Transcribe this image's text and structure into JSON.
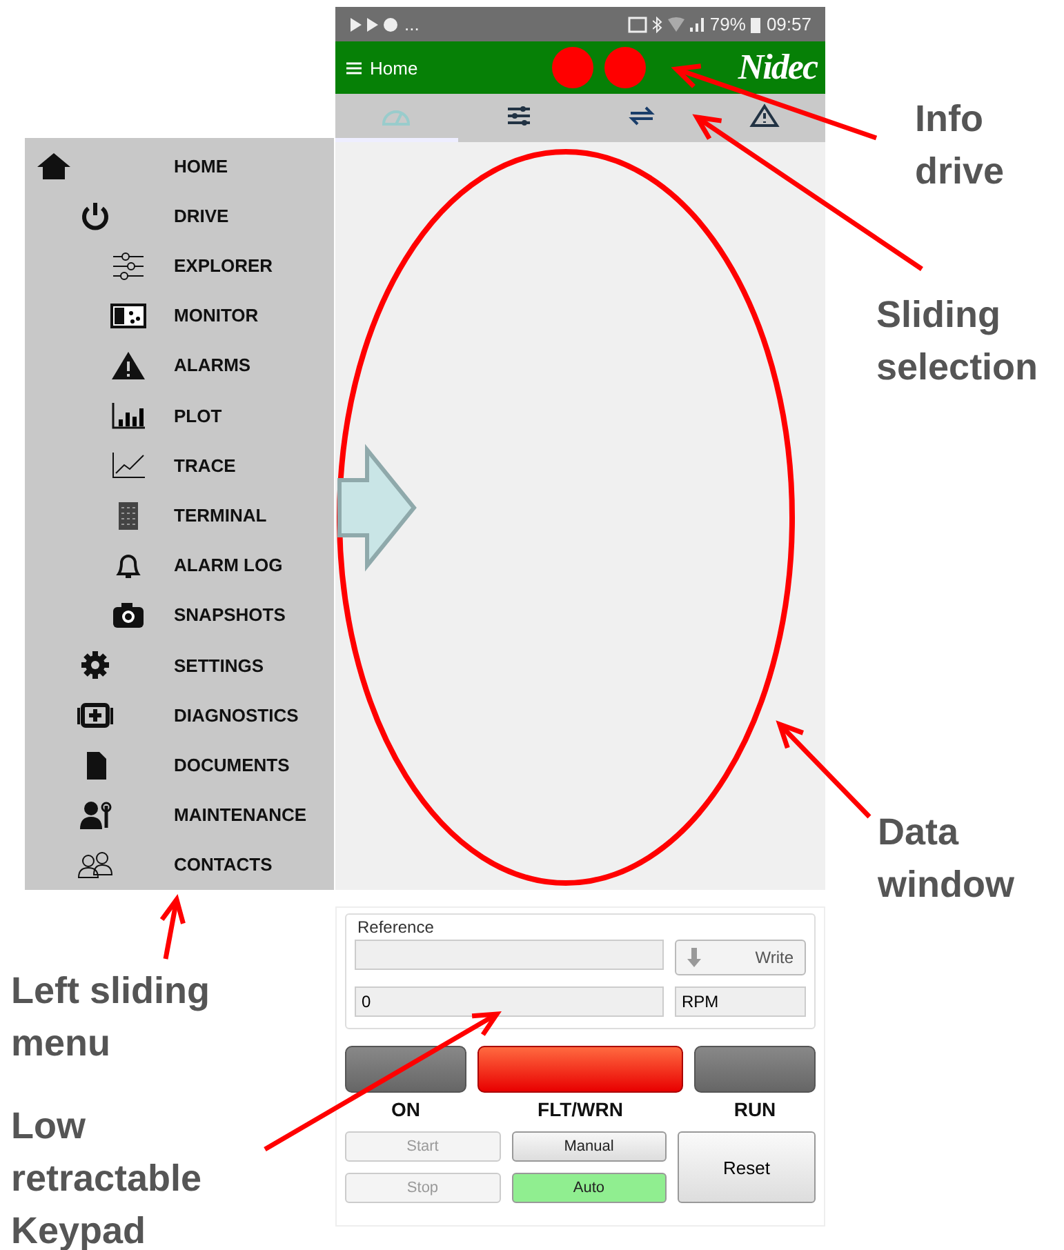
{
  "status_bar": {
    "more": "...",
    "battery": "79%",
    "time": "09:57"
  },
  "header": {
    "title": "Home",
    "indicators": [
      {
        "color": "#ff0000"
      },
      {
        "color": "#ff0000"
      }
    ],
    "logo": "Nidec"
  },
  "tabs": [
    {
      "selected": true
    },
    {
      "selected": false
    },
    {
      "selected": false
    },
    {
      "selected": false
    }
  ],
  "menu": {
    "items": [
      {
        "label": "HOME"
      },
      {
        "label": "DRIVE",
        "children": [
          {
            "label": "EXPLORER"
          },
          {
            "label": "MONITOR"
          },
          {
            "label": "ALARMS"
          },
          {
            "label": "PLOT"
          },
          {
            "label": "TRACE"
          },
          {
            "label": "TERMINAL"
          },
          {
            "label": "ALARM LOG"
          },
          {
            "label": "SNAPSHOTS"
          }
        ]
      },
      {
        "label": "SETTINGS"
      },
      {
        "label": "DIAGNOSTICS"
      },
      {
        "label": "DOCUMENTS"
      },
      {
        "label": "MAINTENANCE"
      },
      {
        "label": "CONTACTS"
      }
    ]
  },
  "keypad": {
    "group": "Reference",
    "write_button": "Write",
    "value": "0",
    "unit": "RPM",
    "lamps": [
      {
        "label": "ON",
        "on": false
      },
      {
        "label": "FLT/WRN",
        "on": true
      },
      {
        "label": "RUN",
        "on": false
      }
    ],
    "buttons": [
      {
        "label": "Start",
        "disabled": true,
        "selected": false
      },
      {
        "label": "Manual",
        "disabled": false,
        "selected": false
      },
      {
        "label": "Stop",
        "disabled": true,
        "selected": false
      },
      {
        "label": "Auto",
        "disabled": false,
        "selected": true
      }
    ],
    "reset_button": "Reset"
  },
  "annotations": [
    {
      "label": "Info drive"
    },
    {
      "label": "Sliding selection"
    },
    {
      "label": "Data window"
    },
    {
      "label": "Left sliding menu"
    },
    {
      "label": "Low retractable Keypad"
    }
  ]
}
